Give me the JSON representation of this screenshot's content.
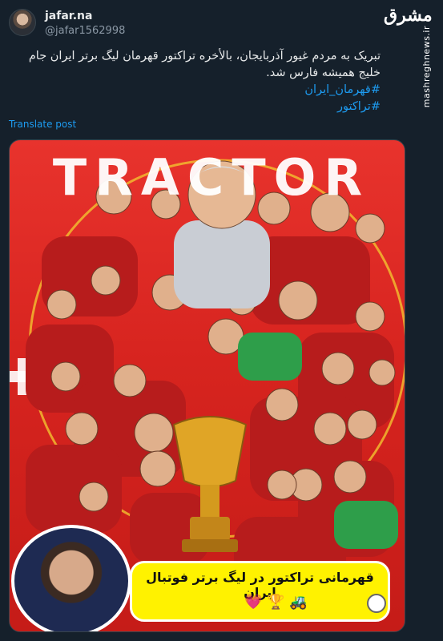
{
  "author": {
    "name": "jafar.na",
    "handle": "@jafar1562998"
  },
  "watermark": {
    "logo": "مشرق",
    "url": "mashreghnews.ir"
  },
  "post": {
    "text": "تبریک به مردم غیور آذربایجان، بالأخره تراکتور قهرمان لیگ برتر ایران جام خلیج همیشه فارس شد.",
    "hashtags": [
      "#قهرمان_ایران",
      "#تراکتور"
    ],
    "translate_label": "Translate post"
  },
  "media": {
    "title": "TRACTOR",
    "caption": "قهرمانی تراکتور در لیگ برتر فوتبال ایران",
    "caption_emoji": [
      "💗",
      "🏆",
      "🚜"
    ],
    "colors": {
      "background": "#e8332d",
      "caption_bg": "#fff200",
      "trophy": "#e0a526"
    }
  },
  "colors": {
    "page_bg": "#15202b",
    "link": "#1d9bf0",
    "muted": "#8b98a5"
  }
}
